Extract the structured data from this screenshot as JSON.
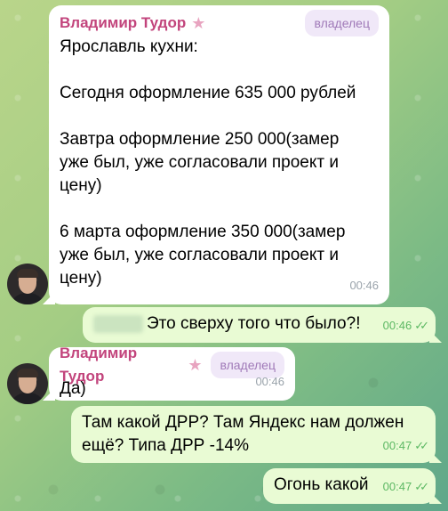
{
  "messages": [
    {
      "sender": "Владимир Тудор",
      "badge": "владелец",
      "text": "Ярославль кухни:\n\nСегодня оформление 635 000 рублей\n\nЗавтра оформление 250 000(замер\nуже был, уже согласовали проект и\nцену)\n\n6 марта оформление 350 000(замер\nуже был, уже согласовали проект и\nцену)",
      "time": "00:46"
    },
    {
      "text": "Это сверху того что было?!",
      "time": "00:46"
    },
    {
      "sender": "Владимир Тудор",
      "badge": "владелец",
      "text": "Да)",
      "time": "00:46"
    },
    {
      "text": "Там какой ДРР? Там Яндекс нам должен\nещё? Типа ДРР -14%",
      "time": "00:47"
    },
    {
      "text": "Огонь какой",
      "time": "00:47"
    }
  ],
  "icons": {
    "star": "star-icon",
    "read": "double-check-icon",
    "avatar": "avatar"
  }
}
